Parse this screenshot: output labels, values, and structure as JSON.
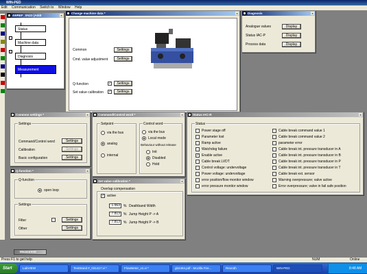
{
  "app": {
    "title": "WIN-PED",
    "menu": [
      "Edit",
      "Communication",
      "Switch to",
      "Window",
      "Help"
    ]
  },
  "valve_win": {
    "title": "4WREF_SN23 (Addr",
    "items": [
      "Status",
      "Machine data",
      "Diagnosis",
      "Measurement"
    ]
  },
  "change_win": {
    "title": "Change machine data *",
    "rows": [
      {
        "label": "Common",
        "btn": "Settings"
      },
      {
        "label": "Cmd. value adjustment",
        "btn": "Settings"
      },
      {
        "label": "Q-function",
        "btn": "Settings",
        "check": "✓"
      },
      {
        "label": "Set value calibration",
        "btn": "Settings",
        "check": "✓"
      }
    ]
  },
  "diag_win": {
    "title": "Diagnosis",
    "rows": [
      {
        "label": "Analogue values",
        "btn": "Display"
      },
      {
        "label": "Status IAC-P",
        "btn": "Display"
      },
      {
        "label": "Process data",
        "btn": "Display"
      }
    ]
  },
  "common_win": {
    "title": "Common settings *",
    "group": "Settings",
    "rows": [
      {
        "label": "Command/Control word",
        "btn": "Settings",
        "disabled": false
      },
      {
        "label": "Calibration",
        "btn": "Settings",
        "disabled": true
      },
      {
        "label": "Basic configuration",
        "btn": "Settings",
        "disabled": false
      }
    ]
  },
  "cmd_win": {
    "title": "Command/Control word *",
    "setpoint": {
      "title": "Setpoint",
      "options": [
        "via the bus",
        "analog",
        "internal"
      ],
      "selected": 1
    },
    "control": {
      "title": "Control word",
      "options": [
        "via the bus",
        "Local mode"
      ],
      "selected": 1,
      "sub": "Behaviour without release",
      "sub_options": [
        "Init",
        "Disabled",
        "Hold"
      ],
      "sub_selected": 1
    }
  },
  "status_win": {
    "title": "Status IAC-R",
    "group": "Status",
    "left": [
      {
        "t": "Power stage off",
        "c": false
      },
      {
        "t": "Parameter lost",
        "c": false
      },
      {
        "t": "Ramp active",
        "c": false
      },
      {
        "t": "Watchdog failure",
        "c": false
      },
      {
        "t": "Enable active",
        "c": true
      },
      {
        "t": "Cable break LVDT",
        "c": false
      },
      {
        "t": "Control voltage: undervoltage",
        "c": false
      },
      {
        "t": "Power voltage: undervoltage",
        "c": false
      },
      {
        "t": "error position/flow monitor window",
        "c": false
      },
      {
        "t": "error pressure monitor window",
        "c": false
      }
    ],
    "right": [
      {
        "t": "Cable break command value 1",
        "c": false
      },
      {
        "t": "Cable break command value 2",
        "c": false
      },
      {
        "t": "parameter error",
        "c": false
      },
      {
        "t": "Cable break int. pressure transducer in A",
        "c": false
      },
      {
        "t": "Cable break int. pressure transducer in B",
        "c": false
      },
      {
        "t": "Cable break int. pressure transducer in P",
        "c": false
      },
      {
        "t": "Cable break int. pressure transducer in T",
        "c": false
      },
      {
        "t": "Cable break ext. sensor",
        "c": false
      },
      {
        "t": "Warning overpressure; valve active",
        "c": false
      },
      {
        "t": "Error overpressure; valve in fail safe position",
        "c": false
      }
    ]
  },
  "qfunc_win": {
    "title": "Q-function *",
    "group": "Q-function",
    "radio": "open loop",
    "group2": "Settings",
    "rows": [
      {
        "label": "Filter",
        "btn": "Settings"
      },
      {
        "label": "Other",
        "btn": "Settings"
      }
    ]
  },
  "setval_win": {
    "title": "Set value calibration *",
    "group": "Overlap compensation",
    "active": "active",
    "rows": [
      {
        "v": "1.563",
        "u": "%",
        "l": "Deathband Width"
      },
      {
        "v": "7.813",
        "u": "%",
        "l": "Jump Height P -> A"
      },
      {
        "v": "7.813",
        "u": "%",
        "l": "Jump Height P -> B"
      }
    ]
  },
  "min_win": {
    "title": "Measuremt"
  },
  "statusbar": {
    "hint": "Press F1 to get help",
    "num": "NUM",
    "online": "Online"
  },
  "taskbar": {
    "start": "Start",
    "items": [
      "LabVIEW",
      "TestStand #_031417.vi *",
      "FlowMeter_v1.vi *",
      "gb2464.pdf - Mozilla Fire...",
      "Rexroth",
      "WIN-PED"
    ],
    "clock": "8:48 AM"
  }
}
